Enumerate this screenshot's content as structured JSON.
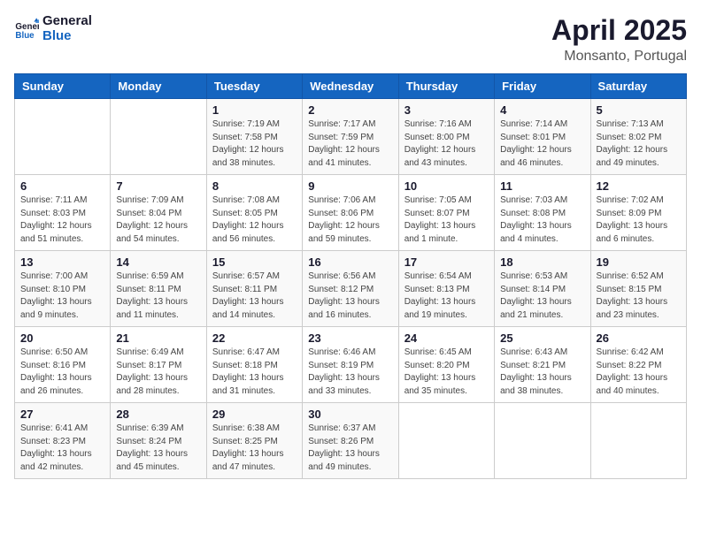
{
  "logo": {
    "line1": "General",
    "line2": "Blue"
  },
  "title": "April 2025",
  "subtitle": "Monsanto, Portugal",
  "weekdays": [
    "Sunday",
    "Monday",
    "Tuesday",
    "Wednesday",
    "Thursday",
    "Friday",
    "Saturday"
  ],
  "weeks": [
    [
      null,
      null,
      {
        "day": 1,
        "sunrise": "7:19 AM",
        "sunset": "7:58 PM",
        "daylight": "12 hours and 38 minutes."
      },
      {
        "day": 2,
        "sunrise": "7:17 AM",
        "sunset": "7:59 PM",
        "daylight": "12 hours and 41 minutes."
      },
      {
        "day": 3,
        "sunrise": "7:16 AM",
        "sunset": "8:00 PM",
        "daylight": "12 hours and 43 minutes."
      },
      {
        "day": 4,
        "sunrise": "7:14 AM",
        "sunset": "8:01 PM",
        "daylight": "12 hours and 46 minutes."
      },
      {
        "day": 5,
        "sunrise": "7:13 AM",
        "sunset": "8:02 PM",
        "daylight": "12 hours and 49 minutes."
      }
    ],
    [
      {
        "day": 6,
        "sunrise": "7:11 AM",
        "sunset": "8:03 PM",
        "daylight": "12 hours and 51 minutes."
      },
      {
        "day": 7,
        "sunrise": "7:09 AM",
        "sunset": "8:04 PM",
        "daylight": "12 hours and 54 minutes."
      },
      {
        "day": 8,
        "sunrise": "7:08 AM",
        "sunset": "8:05 PM",
        "daylight": "12 hours and 56 minutes."
      },
      {
        "day": 9,
        "sunrise": "7:06 AM",
        "sunset": "8:06 PM",
        "daylight": "12 hours and 59 minutes."
      },
      {
        "day": 10,
        "sunrise": "7:05 AM",
        "sunset": "8:07 PM",
        "daylight": "13 hours and 1 minute."
      },
      {
        "day": 11,
        "sunrise": "7:03 AM",
        "sunset": "8:08 PM",
        "daylight": "13 hours and 4 minutes."
      },
      {
        "day": 12,
        "sunrise": "7:02 AM",
        "sunset": "8:09 PM",
        "daylight": "13 hours and 6 minutes."
      }
    ],
    [
      {
        "day": 13,
        "sunrise": "7:00 AM",
        "sunset": "8:10 PM",
        "daylight": "13 hours and 9 minutes."
      },
      {
        "day": 14,
        "sunrise": "6:59 AM",
        "sunset": "8:11 PM",
        "daylight": "13 hours and 11 minutes."
      },
      {
        "day": 15,
        "sunrise": "6:57 AM",
        "sunset": "8:11 PM",
        "daylight": "13 hours and 14 minutes."
      },
      {
        "day": 16,
        "sunrise": "6:56 AM",
        "sunset": "8:12 PM",
        "daylight": "13 hours and 16 minutes."
      },
      {
        "day": 17,
        "sunrise": "6:54 AM",
        "sunset": "8:13 PM",
        "daylight": "13 hours and 19 minutes."
      },
      {
        "day": 18,
        "sunrise": "6:53 AM",
        "sunset": "8:14 PM",
        "daylight": "13 hours and 21 minutes."
      },
      {
        "day": 19,
        "sunrise": "6:52 AM",
        "sunset": "8:15 PM",
        "daylight": "13 hours and 23 minutes."
      }
    ],
    [
      {
        "day": 20,
        "sunrise": "6:50 AM",
        "sunset": "8:16 PM",
        "daylight": "13 hours and 26 minutes."
      },
      {
        "day": 21,
        "sunrise": "6:49 AM",
        "sunset": "8:17 PM",
        "daylight": "13 hours and 28 minutes."
      },
      {
        "day": 22,
        "sunrise": "6:47 AM",
        "sunset": "8:18 PM",
        "daylight": "13 hours and 31 minutes."
      },
      {
        "day": 23,
        "sunrise": "6:46 AM",
        "sunset": "8:19 PM",
        "daylight": "13 hours and 33 minutes."
      },
      {
        "day": 24,
        "sunrise": "6:45 AM",
        "sunset": "8:20 PM",
        "daylight": "13 hours and 35 minutes."
      },
      {
        "day": 25,
        "sunrise": "6:43 AM",
        "sunset": "8:21 PM",
        "daylight": "13 hours and 38 minutes."
      },
      {
        "day": 26,
        "sunrise": "6:42 AM",
        "sunset": "8:22 PM",
        "daylight": "13 hours and 40 minutes."
      }
    ],
    [
      {
        "day": 27,
        "sunrise": "6:41 AM",
        "sunset": "8:23 PM",
        "daylight": "13 hours and 42 minutes."
      },
      {
        "day": 28,
        "sunrise": "6:39 AM",
        "sunset": "8:24 PM",
        "daylight": "13 hours and 45 minutes."
      },
      {
        "day": 29,
        "sunrise": "6:38 AM",
        "sunset": "8:25 PM",
        "daylight": "13 hours and 47 minutes."
      },
      {
        "day": 30,
        "sunrise": "6:37 AM",
        "sunset": "8:26 PM",
        "daylight": "13 hours and 49 minutes."
      },
      null,
      null,
      null
    ]
  ]
}
